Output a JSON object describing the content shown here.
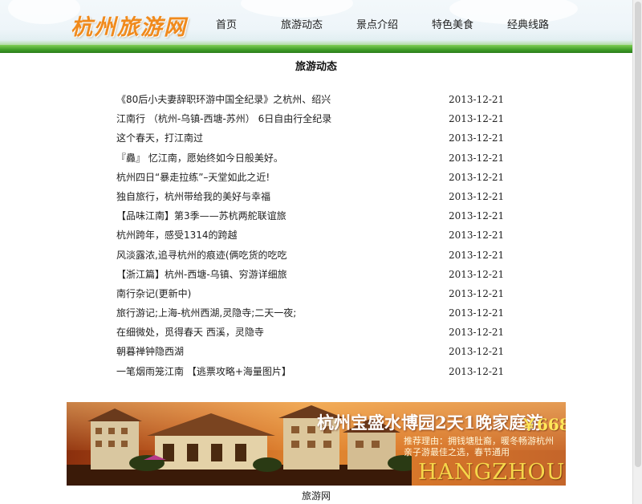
{
  "header": {
    "logo": "杭州旅游网",
    "nav": [
      "首页",
      "旅游动态",
      "景点介绍",
      "特色美食",
      "经典线路"
    ]
  },
  "section": {
    "title": "旅游动态"
  },
  "news": [
    {
      "title": "《80后小夫妻辞职环游中国全纪录》之杭州、绍兴",
      "date": "2013-12-21"
    },
    {
      "title": "江南行 （杭州-乌镇-西塘-苏州） 6日自由行全纪录",
      "date": "2013-12-21"
    },
    {
      "title": "这个春天，打江南过",
      "date": "2013-12-21"
    },
    {
      "title": "『灥』 忆江南，愿始终如今日般美好。",
      "date": "2013-12-21"
    },
    {
      "title": "杭州四日“暴走拉练”–天堂如此之近!",
      "date": "2013-12-21"
    },
    {
      "title": "独自旅行，杭州带给我的美好与幸福",
      "date": "2013-12-21"
    },
    {
      "title": "【品味江南】第3季——苏杭两舵联谊旅",
      "date": "2013-12-21"
    },
    {
      "title": "杭州跨年，感受1314的跨越",
      "date": "2013-12-21"
    },
    {
      "title": "风淡露浓,追寻杭州的痕迹(俩吃货的吃吃",
      "date": "2013-12-21"
    },
    {
      "title": "【浙江篇】杭州-西塘-乌镇、穷游详细旅",
      "date": "2013-12-21"
    },
    {
      "title": "南行杂记(更新中)",
      "date": "2013-12-21"
    },
    {
      "title": "旅行游记;上海-杭州西湖,灵隐寺;二天一夜;",
      "date": "2013-12-21"
    },
    {
      "title": "在细微处，觅得春天  西溪，灵隐寺",
      "date": "2013-12-21"
    },
    {
      "title": "朝暮禅钟隐西湖",
      "date": "2013-12-21"
    },
    {
      "title": "一笔烟雨笼江南 【逃票攻略+海量图片】",
      "date": "2013-12-21"
    }
  ],
  "banner": {
    "headline": "杭州宝盛水博园2天1晚家庭游",
    "price": "￥668",
    "reason_line1": "推荐理由：拥钱塘肚裔，暖冬畅游杭州",
    "reason_line2": "亲子游最佳之选，春节通用",
    "city": "HANGZHOU"
  },
  "footer": {
    "text": "旅游网"
  },
  "colors": {
    "logo": "#f08a1c",
    "nav_band": "#3f9d27",
    "banner_accent": "#f6d64a"
  }
}
